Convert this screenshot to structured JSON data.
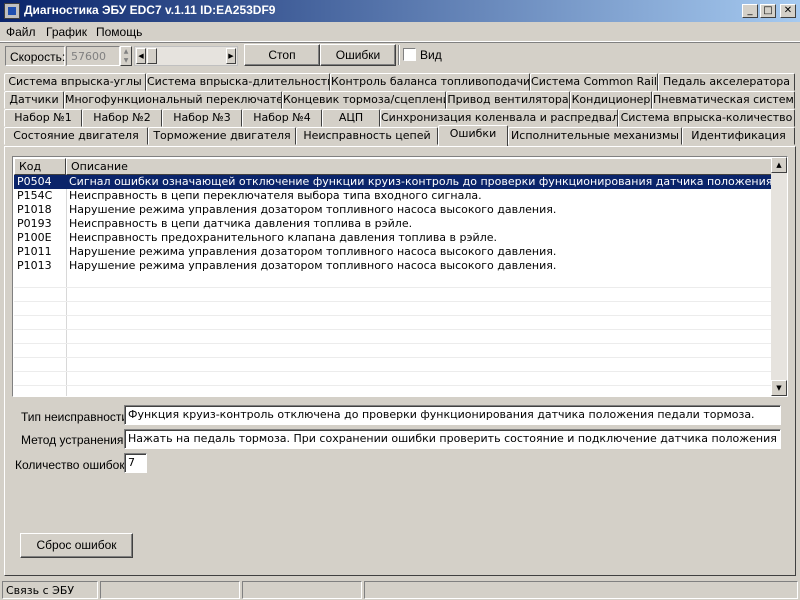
{
  "window": {
    "title": "Диагностика ЭБУ EDC7 v.1.11 ID:EA253DF9",
    "min_glyph": "_",
    "max_glyph": "□",
    "close_glyph": "✕"
  },
  "menu": {
    "items": [
      "Файл",
      "График",
      "Помощь"
    ]
  },
  "toolbar": {
    "speed_label": "Скорость:",
    "speed_value": "57600",
    "stop_label": "Стоп",
    "errors_label": "Ошибки",
    "view_label": "Вид",
    "view_checked": false
  },
  "tabs": {
    "row1": [
      "Система впрыска-углы",
      "Система впрыска-длительность",
      "Контроль баланса топливоподачи",
      "Система Common Rail",
      "Педаль акселератора"
    ],
    "row2": [
      "Датчики",
      "Многофункциональный переключатель",
      "Концевик тормоза/сцепления",
      "Привод вентилятора",
      "Кондиционер",
      "Пневматическая система"
    ],
    "row3": [
      "Набор №1",
      "Набор №2",
      "Набор №3",
      "Набор №4",
      "АЦП",
      "Синхронизация коленвала и распредвала",
      "Система впрыска-количество"
    ],
    "row4": [
      "Состояние двигателя",
      "Торможение двигателя",
      "Неисправность цепей",
      "Ошибки",
      "Исполнительные механизмы",
      "Идентификация"
    ],
    "active": "Ошибки"
  },
  "errors_table": {
    "columns": [
      "Код",
      "Описание"
    ],
    "rows": [
      {
        "code": "P0504",
        "description": "Сигнал ошибки означающей отключение функции круиз-контроль до проверки функционирования датчика положения педали торм..."
      },
      {
        "code": "P154C",
        "description": "Неисправность в цепи переключателя выбора типа входного сигнала."
      },
      {
        "code": "P1018",
        "description": "Нарушение режима управления дозатором топливного насоса высокого давления."
      },
      {
        "code": "P0193",
        "description": "Неисправность в цепи датчика давления топлива в рэйле."
      },
      {
        "code": "P100E",
        "description": "Неисправность предохранительного клапана давления топлива в рэйле."
      },
      {
        "code": "P1011",
        "description": "Нарушение режима управления дозатором топливного насоса высокого давления."
      },
      {
        "code": "P1013",
        "description": "Нарушение режима управления дозатором топливного насоса высокого давления."
      }
    ],
    "selected_index": 0
  },
  "details": {
    "fault_type_label": "Тип неисправности:",
    "fault_type_value": "Функция круиз-контроль отключена до проверки функционирования датчика положения педали тормоза.",
    "fix_label": "Метод устранения:",
    "fix_value": "Нажать на педаль тормоза. При сохранении ошибки проверить состояние и подключение датчика положения педали тормоза.",
    "count_label": "Количество ошибок:",
    "count_value": "7"
  },
  "actions": {
    "reset_label": "Сброс ошибок"
  },
  "status": {
    "connection": "Связь с ЭБУ"
  },
  "colors": {
    "face": "#d4d0c8",
    "selection": "#0a246a",
    "title_start": "#0a246a",
    "title_end": "#a6caf0"
  }
}
